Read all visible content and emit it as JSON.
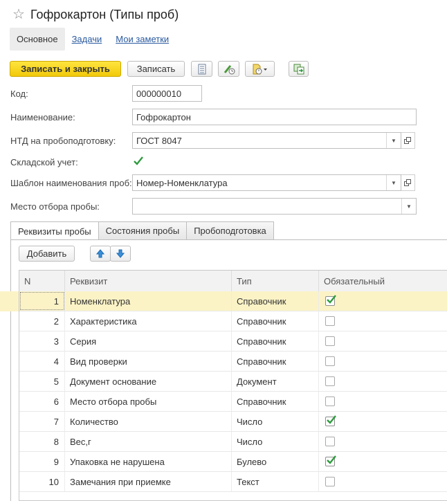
{
  "window": {
    "title": "Гофрокартон (Типы проб)"
  },
  "nav": {
    "tabs": [
      "Основное",
      "Задачи",
      "Мои заметки"
    ]
  },
  "toolbar": {
    "save_close": "Записать и закрыть",
    "save": "Записать"
  },
  "form": {
    "code_label": "Код:",
    "code_value": "000000010",
    "name_label": "Наименование:",
    "name_value": "Гофрокартон",
    "ntd_label": "НТД на пробоподготовку:",
    "ntd_value": "ГОСТ 8047",
    "stock_label": "Складской учет:",
    "stock_checked": true,
    "template_label": "Шаблон наименования проб:",
    "template_value": "Номер-Номенклатура",
    "place_label": "Место отбора пробы:",
    "place_value": ""
  },
  "tabs": [
    "Реквизиты пробы",
    "Состояния пробы",
    "Пробоподготовка"
  ],
  "table": {
    "add_button": "Добавить",
    "columns": [
      "N",
      "Реквизит",
      "Тип",
      "Обязательный"
    ],
    "rows": [
      {
        "n": "1",
        "name": "Номенклатура",
        "type": "Справочник",
        "required": true
      },
      {
        "n": "2",
        "name": "Характеристика",
        "type": "Справочник",
        "required": false
      },
      {
        "n": "3",
        "name": "Серия",
        "type": "Справочник",
        "required": false
      },
      {
        "n": "4",
        "name": "Вид проверки",
        "type": "Справочник",
        "required": false
      },
      {
        "n": "5",
        "name": "Документ основание",
        "type": "Документ",
        "required": false
      },
      {
        "n": "6",
        "name": "Место отбора пробы",
        "type": "Справочник",
        "required": false
      },
      {
        "n": "7",
        "name": "Количество",
        "type": "Число",
        "required": true
      },
      {
        "n": "8",
        "name": "Вес,г",
        "type": "Число",
        "required": false
      },
      {
        "n": "9",
        "name": "Упаковка не нарушена",
        "type": "Булево",
        "required": true
      },
      {
        "n": "10",
        "name": "Замечания при приемке",
        "type": "Текст",
        "required": false
      }
    ]
  },
  "colors": {
    "accent_yellow": "#f5d320",
    "selected_row": "#fbf3c6",
    "check_green": "#2e9b3e",
    "link": "#2a5aa0"
  }
}
